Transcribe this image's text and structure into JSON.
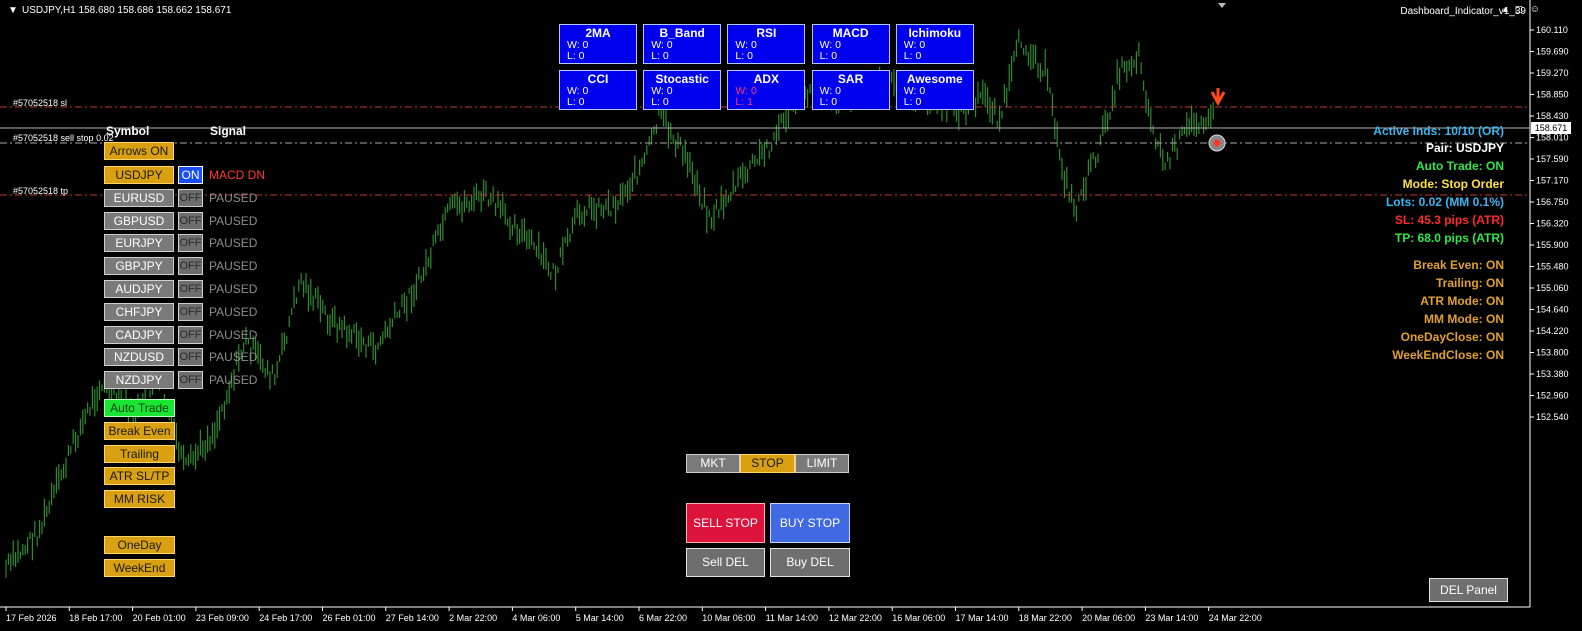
{
  "header": {
    "symbol_info": "USDJPY,H1  158.680 158.686 158.662 158.671",
    "indicator_name": "Dashboard_Indicator_v1_39",
    "window_controls": "▴ ◻ ☺"
  },
  "chart_lines": {
    "sl_label": "#57052518 sl",
    "sell_stop_label": "#57052518 sell stop 0.02",
    "tp_label": "#57052518 tp"
  },
  "current_price": "158.671",
  "colors": {
    "candle": "#2e8b2e",
    "sl_line": "#c0392b",
    "tp_line": "#c0392b",
    "entry_line": "#a9a9a9",
    "panel_orange": "#d9a011",
    "panel_blue": "#0000ee"
  },
  "price_axis": [
    "160.110",
    "159.690",
    "159.270",
    "158.850",
    "158.430",
    "158.010",
    "157.590",
    "157.170",
    "156.750",
    "156.320",
    "155.900",
    "155.480",
    "155.060",
    "154.640",
    "154.220",
    "153.800",
    "153.380",
    "152.960",
    "152.540"
  ],
  "time_axis": [
    "17 Feb 2026",
    "18 Feb 17:00",
    "20 Feb 01:00",
    "23 Feb 09:00",
    "24 Feb 17:00",
    "26 Feb 01:00",
    "27 Feb 14:00",
    "2 Mar 22:00",
    "4 Mar 06:00",
    "5 Mar 14:00",
    "6 Mar 22:00",
    "10 Mar 06:00",
    "11 Mar 14:00",
    "12 Mar 22:00",
    "16 Mar 06:00",
    "17 Mar 14:00",
    "18 Mar 22:00",
    "20 Mar 06:00",
    "23 Mar 14:00",
    "24 Mar 22:00"
  ],
  "left_panel": {
    "symbol_header": "Symbol",
    "signal_header": "Signal",
    "arrows_button": "Arrows ON",
    "pairs": [
      {
        "symbol": "USDJPY",
        "state": "ON",
        "signal": "MACD DN",
        "active": true
      },
      {
        "symbol": "EURUSD",
        "state": "OFF",
        "signal": "PAUSED",
        "active": false
      },
      {
        "symbol": "GBPUSD",
        "state": "OFF",
        "signal": "PAUSED",
        "active": false
      },
      {
        "symbol": "EURJPY",
        "state": "OFF",
        "signal": "PAUSED",
        "active": false
      },
      {
        "symbol": "GBPJPY",
        "state": "OFF",
        "signal": "PAUSED",
        "active": false
      },
      {
        "symbol": "AUDJPY",
        "state": "OFF",
        "signal": "PAUSED",
        "active": false
      },
      {
        "symbol": "CHFJPY",
        "state": "OFF",
        "signal": "PAUSED",
        "active": false
      },
      {
        "symbol": "CADJPY",
        "state": "OFF",
        "signal": "PAUSED",
        "active": false
      },
      {
        "symbol": "NZDUSD",
        "state": "OFF",
        "signal": "PAUSED",
        "active": false
      },
      {
        "symbol": "NZDJPY",
        "state": "OFF",
        "signal": "PAUSED",
        "active": false
      }
    ],
    "auto_trade": "Auto Trade",
    "break_even": "Break Even",
    "trailing": "Trailing",
    "atr_sltp": "ATR SL/TP",
    "mm_risk": "MM RISK",
    "one_day": "OneDay",
    "week_end": "WeekEnd"
  },
  "indicators": [
    {
      "name": "2MA",
      "w": "W: 0",
      "l": "L:  0",
      "red": false
    },
    {
      "name": "B_Band",
      "w": "W: 0",
      "l": "L:  0",
      "red": false
    },
    {
      "name": "RSI",
      "w": "W: 0",
      "l": "L:  0",
      "red": false
    },
    {
      "name": "MACD",
      "w": "W: 0",
      "l": "L:  0",
      "red": false
    },
    {
      "name": "Ichimoku",
      "w": "W: 0",
      "l": "L:  0",
      "red": false
    },
    {
      "name": "CCI",
      "w": "W: 0",
      "l": "L:  0",
      "red": false
    },
    {
      "name": "Stocastic",
      "w": "W: 0",
      "l": "L:  0",
      "red": false
    },
    {
      "name": "ADX",
      "w": "W: 0",
      "l": "L:  1",
      "red": true
    },
    {
      "name": "SAR",
      "w": "W: 0",
      "l": "L:  0",
      "red": false
    },
    {
      "name": "Awesome",
      "w": "W: 0",
      "l": "L:  0",
      "red": false
    }
  ],
  "order_types": {
    "mkt": "MKT",
    "stop": "STOP",
    "limit": "LIMIT"
  },
  "actions": {
    "sell_stop": "SELL STOP",
    "buy_stop": "BUY STOP",
    "sell_del": "Sell DEL",
    "buy_del": "Buy DEL",
    "del_panel": "DEL Panel"
  },
  "status": [
    {
      "text": "Active Inds: 10/10 (OR)",
      "color": "#3cb6f0"
    },
    {
      "text": "Pair: USDJPY",
      "color": "#ffffff"
    },
    {
      "text": "Auto Trade: ON",
      "color": "#32e64a"
    },
    {
      "text": "Mode: Stop Order",
      "color": "#ffe040"
    },
    {
      "text": "Lots: 0.02 (MM 0.1%)",
      "color": "#3cb6f0"
    },
    {
      "text": "SL: 45.3 pips (ATR)",
      "color": "#ff2a2a"
    },
    {
      "text": "TP: 68.0 pips (ATR)",
      "color": "#32e64a"
    },
    {
      "text": "Break Even: ON",
      "color": "#e0a030"
    },
    {
      "text": "Trailing: ON",
      "color": "#e0a030"
    },
    {
      "text": "ATR Mode: ON",
      "color": "#e0a030"
    },
    {
      "text": "MM Mode: ON",
      "color": "#e0a030"
    },
    {
      "text": "OneDayClose: ON",
      "color": "#e0a030"
    },
    {
      "text": "WeekEndClose: ON",
      "color": "#e0a030"
    }
  ]
}
